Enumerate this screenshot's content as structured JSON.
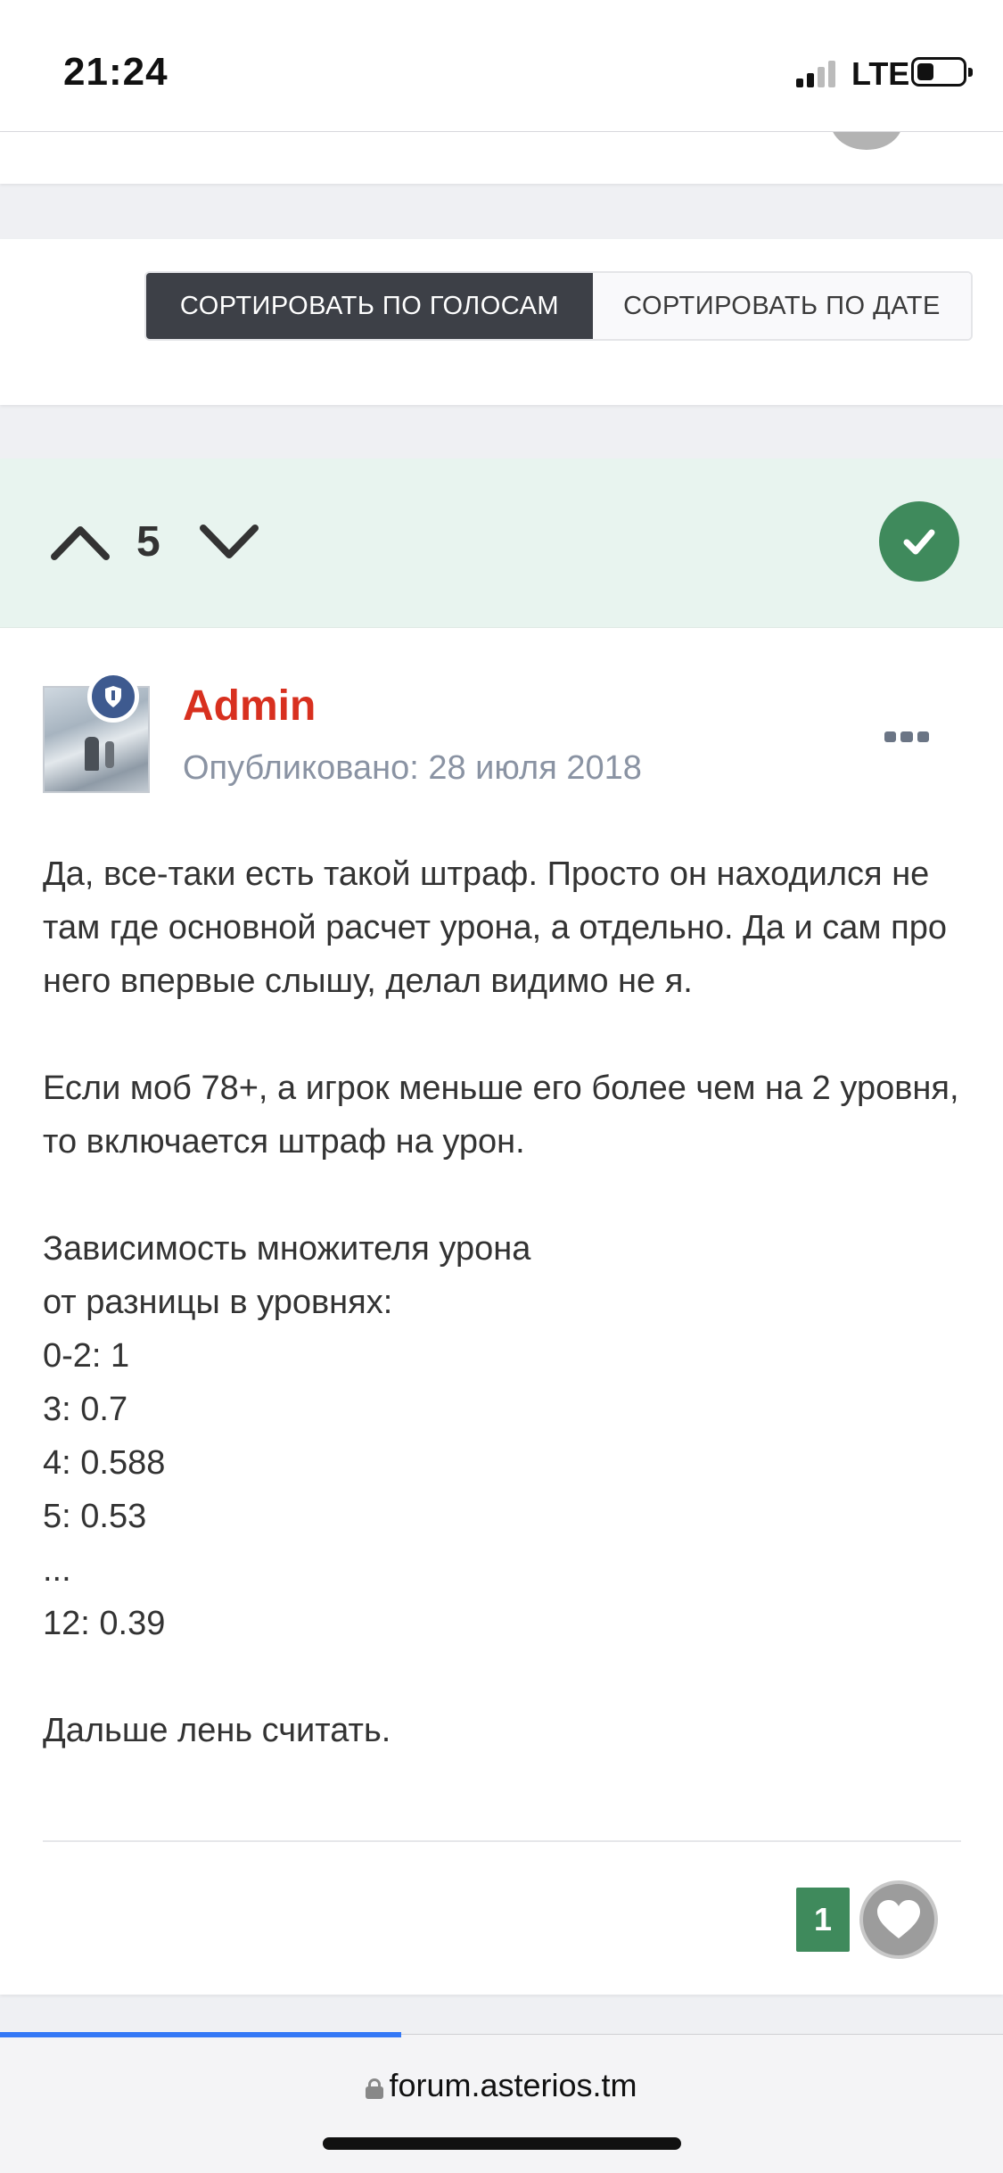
{
  "status_bar": {
    "time": "21:24",
    "network": "LTE",
    "battery_level": 0.35
  },
  "sort": {
    "by_votes": "СОРТИРОВАТЬ ПО ГОЛОСАМ",
    "by_date": "СОРТИРОВАТЬ ПО ДАТЕ",
    "active": "by_votes"
  },
  "post": {
    "vote_count": "5",
    "author": "Admin",
    "published": "Опубликовано: 28 июля 2018",
    "body": [
      "Да, все-таки есть такой штраф. Просто он находился не там где основной расчет урона, а отдельно. Да и сам про него впервые слышу, делал видимо не я.",
      "",
      "Если моб 78+, а игрок меньше его более чем на 2 уровня, то включается штраф на урон.",
      "",
      "Зависимость множителя урона",
      "от разницы в уровнях:",
      "0-2: 1",
      "3: 0.7",
      "4: 0.588",
      "5: 0.53",
      "...",
      "12: 0.39",
      "",
      "Дальше лень считать."
    ],
    "like_count": "1"
  },
  "browser": {
    "url": "forum.asterios.tm",
    "load_progress": 0.4
  },
  "colors": {
    "author": "#d8301f",
    "accepted": "#3f8a5c",
    "vote_bar_bg": "#e8f4ef",
    "progress": "#3478f6"
  },
  "icons": [
    "signal-icon",
    "battery-icon",
    "upvote-icon",
    "downvote-icon",
    "accepted-check-icon",
    "moderator-shield-icon",
    "more-options-icon",
    "heart-icon",
    "lock-icon"
  ]
}
